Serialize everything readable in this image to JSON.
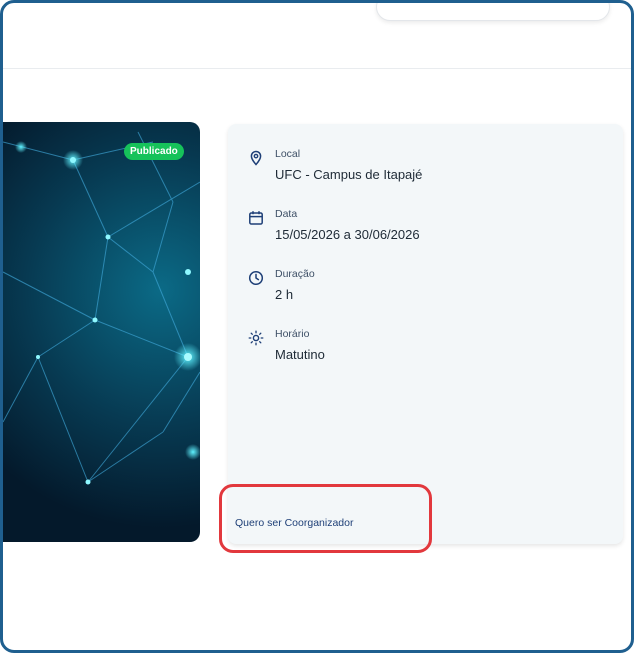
{
  "event": {
    "status_badge": "Publicado",
    "details": {
      "local": {
        "label": "Local",
        "value": "UFC - Campus de Itapajé",
        "icon": "location-pin-icon"
      },
      "data": {
        "label": "Data",
        "value": "15/05/2026 a 30/06/2026",
        "icon": "calendar-icon"
      },
      "duracao": {
        "label": "Duração",
        "value": "2 h",
        "icon": "clock-icon"
      },
      "horario": {
        "label": "Horário",
        "value": "Matutino",
        "icon": "sun-icon"
      }
    },
    "coorganizer_link": "Quero ser Coorganizador"
  },
  "colors": {
    "badge": "#16c25a",
    "card_bg": "#f3f7f9",
    "link": "#1e3f77",
    "highlight": "#e2383d",
    "frame": "#1f5f8f"
  }
}
